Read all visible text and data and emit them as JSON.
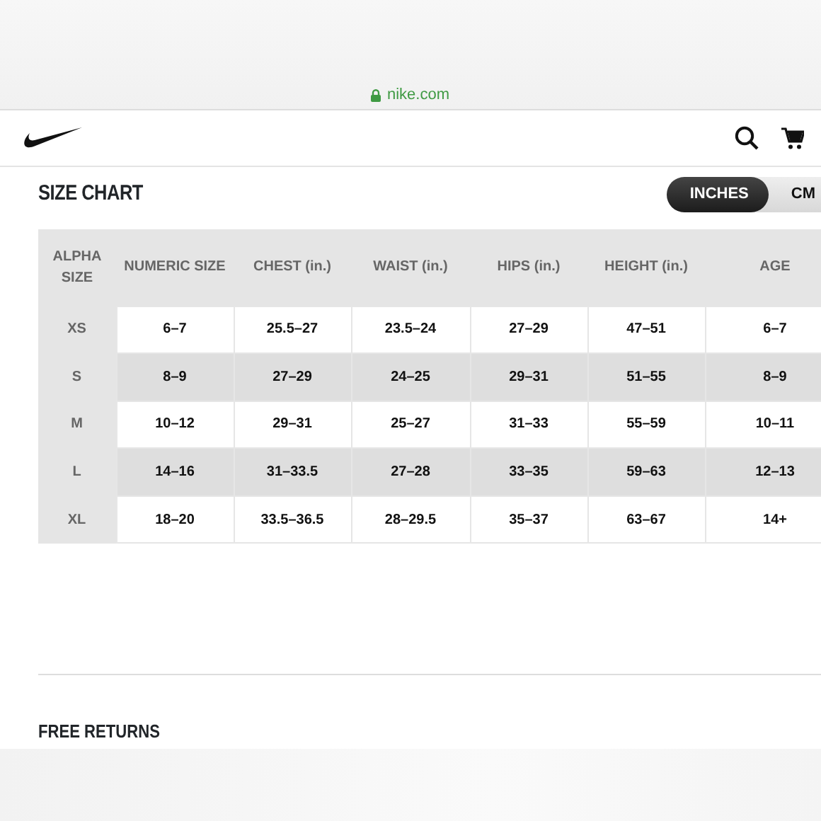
{
  "browser": {
    "url": "nike.com",
    "secure": true
  },
  "title": "SIZE CHART",
  "units": [
    {
      "label": "INCHES",
      "selected": true
    },
    {
      "label": "CM",
      "selected": false
    }
  ],
  "table": {
    "columns": [
      "ALPHA SIZE",
      "NUMERIC SIZE",
      "CHEST (in.)",
      "WAIST (in.)",
      "HIPS (in.)",
      "HEIGHT (in.)",
      "AGE"
    ],
    "rows": [
      [
        "XS",
        "6–7",
        "25.5–27",
        "23.5–24",
        "27–29",
        "47–51",
        "6–7"
      ],
      [
        "S",
        "8–9",
        "27–29",
        "24–25",
        "29–31",
        "51–55",
        "8–9"
      ],
      [
        "M",
        "10–12",
        "29–31",
        "25–27",
        "31–33",
        "55–59",
        "10–11"
      ],
      [
        "L",
        "14–16",
        "31–33.5",
        "27–28",
        "33–35",
        "59–63",
        "12–13"
      ],
      [
        "XL",
        "18–20",
        "33.5–36.5",
        "28–29.5",
        "35–37",
        "63–67",
        "14+"
      ]
    ]
  },
  "next_section": "FREE RETURNS"
}
